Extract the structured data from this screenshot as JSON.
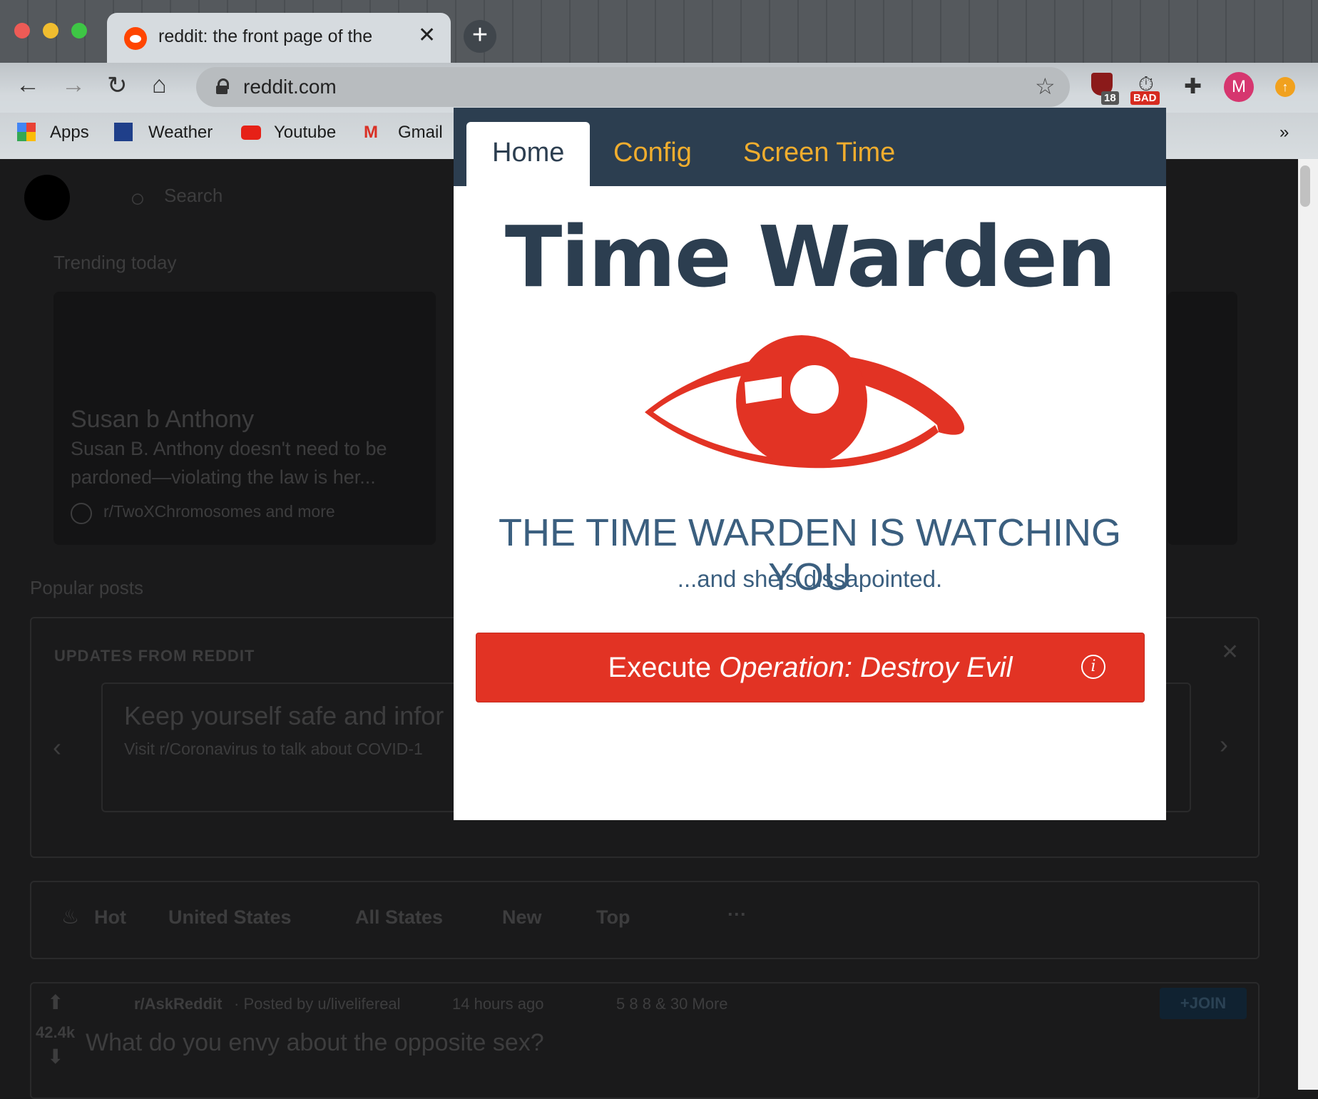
{
  "browser": {
    "tab_title": "reddit: the front page of the int",
    "tab_close": "✕",
    "new_tab": "+",
    "url": "reddit.com",
    "bookmarks": [
      {
        "label": "Apps"
      },
      {
        "label": "Weather"
      },
      {
        "label": "Youtube"
      },
      {
        "label": "Gmail"
      }
    ],
    "bookmarks_more": "»",
    "extensions": {
      "ublock_count": "18",
      "timer_badge": "BAD",
      "profile_initial": "M"
    }
  },
  "reddit": {
    "search_placeholder": "Search",
    "trending_heading": "Trending today",
    "trending_card": {
      "title": "Susan b Anthony",
      "text": "Susan B. Anthony doesn't need to be pardoned—violating the law is her...",
      "meta": "r/TwoXChromosomes and more"
    },
    "popular_heading": "Popular posts",
    "updates_heading": "UPDATES FROM REDDIT",
    "update_title": "Keep yourself safe and infor",
    "update_text": "Visit r/Coronavirus to talk about COVID-1",
    "sort_bar": [
      "Hot",
      "United States",
      "All States",
      "New",
      "Top",
      "···"
    ],
    "post": {
      "subreddit": "r/AskReddit",
      "posted_by": "· Posted by u/livelifereal",
      "time": "14 hours ago",
      "awards": "5    8    8 & 30 More",
      "votes": "42.4k",
      "title": "What do you envy about the opposite sex?",
      "join": "+JOIN"
    }
  },
  "extension_popup": {
    "tabs": [
      {
        "label": "Home",
        "active": true
      },
      {
        "label": "Config",
        "active": false
      },
      {
        "label": "Screen Time",
        "active": false
      }
    ],
    "title": "Time Warden",
    "headline": "THE TIME WARDEN IS WATCHING YOU",
    "subline": "...and she's dissapointed.",
    "button_prefix": "Execute ",
    "button_emphasis": "Operation: Destroy Evil",
    "info_symbol": "i",
    "colors": {
      "navy": "#2c3e50",
      "tab_accent": "#f0ad2e",
      "red": "#e23324",
      "text_blue": "#3b5f7f"
    }
  }
}
